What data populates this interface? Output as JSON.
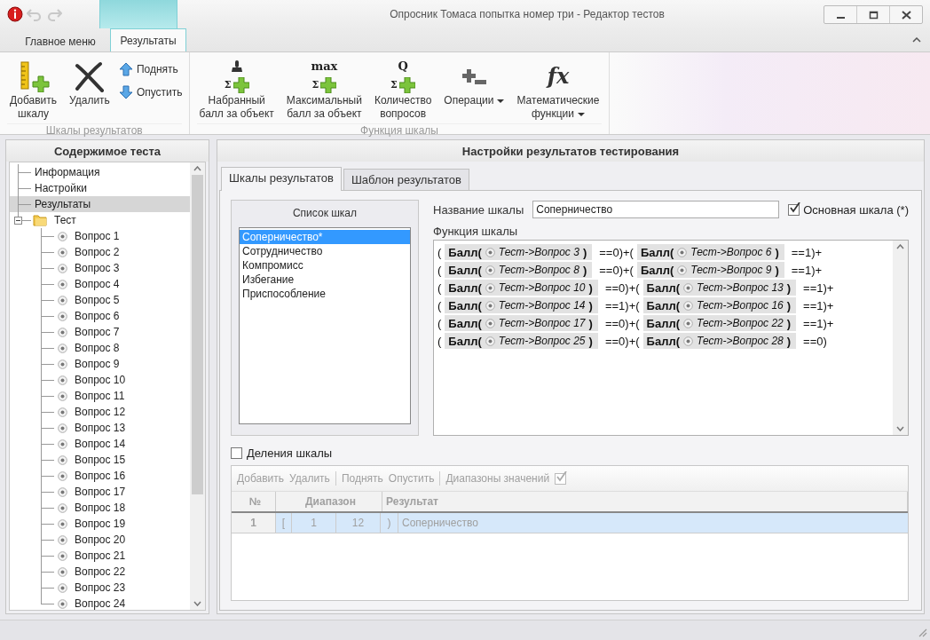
{
  "window": {
    "title": "Опросник Томаса попытка номер три - Редактор тестов"
  },
  "ribbon": {
    "tabs": [
      {
        "label": "Главное меню",
        "selected": false
      },
      {
        "label": "Результаты",
        "selected": true
      }
    ],
    "groups": [
      {
        "label": "Шкалы результатов",
        "buttons": [
          {
            "kind": "large",
            "label": "Добавить\nшкалу"
          },
          {
            "kind": "large",
            "label": "Удалить"
          },
          {
            "kind": "small",
            "label": "Поднять"
          },
          {
            "kind": "small",
            "label": "Опустить"
          }
        ]
      },
      {
        "label": "Функция шкалы",
        "buttons": [
          {
            "kind": "large",
            "label": "Набранный\nбалл за объект",
            "icon_sigma": "Σ"
          },
          {
            "kind": "large",
            "label": "Максимальный\nбалл за объект",
            "icon_text": "max",
            "icon_sigma": "Σ"
          },
          {
            "kind": "large",
            "label": "Количество\nвопросов",
            "icon_text": "Q",
            "icon_sigma": "Σ"
          },
          {
            "kind": "dropdown",
            "label": "Операции"
          },
          {
            "kind": "dropdown",
            "label": "Математические\nфункции",
            "icon_text": "fx"
          }
        ]
      }
    ]
  },
  "left_panel": {
    "title": "Содержимое теста",
    "tree": [
      {
        "label": "Информация",
        "kind": "leaf",
        "selected": false
      },
      {
        "label": "Настройки",
        "kind": "leaf",
        "selected": false
      },
      {
        "label": "Результаты",
        "kind": "leaf",
        "selected": true
      },
      {
        "label": "Тест",
        "kind": "folder",
        "selected": false,
        "expanded": true,
        "children": [
          {
            "label": "Вопрос 1",
            "kind": "question",
            "selected": false
          },
          {
            "label": "Вопрос 2",
            "kind": "question",
            "selected": false
          },
          {
            "label": "Вопрос 3",
            "kind": "question",
            "selected": false
          },
          {
            "label": "Вопрос 4",
            "kind": "question",
            "selected": false
          },
          {
            "label": "Вопрос 5",
            "kind": "question",
            "selected": false
          },
          {
            "label": "Вопрос 6",
            "kind": "question",
            "selected": false
          },
          {
            "label": "Вопрос 7",
            "kind": "question",
            "selected": false
          },
          {
            "label": "Вопрос 8",
            "kind": "question",
            "selected": false
          },
          {
            "label": "Вопрос 9",
            "kind": "question",
            "selected": false
          },
          {
            "label": "Вопрос 10",
            "kind": "question",
            "selected": false
          },
          {
            "label": "Вопрос 11",
            "kind": "question",
            "selected": false
          },
          {
            "label": "Вопрос 12",
            "kind": "question",
            "selected": false
          },
          {
            "label": "Вопрос 13",
            "kind": "question",
            "selected": false
          },
          {
            "label": "Вопрос 14",
            "kind": "question",
            "selected": false
          },
          {
            "label": "Вопрос 15",
            "kind": "question",
            "selected": false
          },
          {
            "label": "Вопрос 16",
            "kind": "question",
            "selected": false
          },
          {
            "label": "Вопрос 17",
            "kind": "question",
            "selected": false
          },
          {
            "label": "Вопрос 18",
            "kind": "question",
            "selected": false
          },
          {
            "label": "Вопрос 19",
            "kind": "question",
            "selected": false
          },
          {
            "label": "Вопрос 20",
            "kind": "question",
            "selected": false
          },
          {
            "label": "Вопрос 21",
            "kind": "question",
            "selected": false
          },
          {
            "label": "Вопрос 22",
            "kind": "question",
            "selected": false
          },
          {
            "label": "Вопрос 23",
            "kind": "question",
            "selected": false
          },
          {
            "label": "Вопрос 24",
            "kind": "question",
            "selected": false
          }
        ]
      }
    ]
  },
  "right_panel": {
    "title": "Настройки результатов тестирования",
    "tabs": [
      {
        "label": "Шкалы результатов",
        "selected": true
      },
      {
        "label": "Шаблон результатов",
        "selected": false
      }
    ],
    "scale_list": {
      "title": "Список шкал",
      "items": [
        {
          "label": "Соперничество*",
          "selected": true
        },
        {
          "label": "Сотрудничество",
          "selected": false
        },
        {
          "label": "Компромисс",
          "selected": false
        },
        {
          "label": "Избегание",
          "selected": false
        },
        {
          "label": "Приспособление",
          "selected": false
        }
      ]
    },
    "name_label": "Название шкалы",
    "name_value": "Соперничество",
    "main_scale": {
      "label": "Основная шкала (*)",
      "checked": true
    },
    "function_label": "Функция шкалы",
    "function_lines": [
      [
        {
          "kind": "text",
          "text": "("
        },
        {
          "kind": "chip",
          "func": "Балл(",
          "ref": "Тест->Вопрос 3",
          "close": ")"
        },
        {
          "kind": "text",
          "text": "==0)+("
        },
        {
          "kind": "chip",
          "func": "Балл(",
          "ref": "Тест->Вопрос 6",
          "close": ")"
        },
        {
          "kind": "text",
          "text": "==1)+"
        }
      ],
      [
        {
          "kind": "text",
          "text": "("
        },
        {
          "kind": "chip",
          "func": "Балл(",
          "ref": "Тест->Вопрос 8",
          "close": ")"
        },
        {
          "kind": "text",
          "text": "==0)+("
        },
        {
          "kind": "chip",
          "func": "Балл(",
          "ref": "Тест->Вопрос 9",
          "close": ")"
        },
        {
          "kind": "text",
          "text": "==1)+"
        }
      ],
      [
        {
          "kind": "text",
          "text": "("
        },
        {
          "kind": "chip",
          "func": "Балл(",
          "ref": "Тест->Вопрос 10",
          "close": ")"
        },
        {
          "kind": "text",
          "text": "==0)+("
        },
        {
          "kind": "chip",
          "func": "Балл(",
          "ref": "Тест->Вопрос 13",
          "close": ")"
        },
        {
          "kind": "text",
          "text": "==1)+"
        }
      ],
      [
        {
          "kind": "text",
          "text": "("
        },
        {
          "kind": "chip",
          "func": "Балл(",
          "ref": "Тест->Вопрос 14",
          "close": ")"
        },
        {
          "kind": "text",
          "text": "==1)+("
        },
        {
          "kind": "chip",
          "func": "Балл(",
          "ref": "Тест->Вопрос 16",
          "close": ")"
        },
        {
          "kind": "text",
          "text": "==1)+"
        }
      ],
      [
        {
          "kind": "text",
          "text": "("
        },
        {
          "kind": "chip",
          "func": "Балл(",
          "ref": "Тест->Вопрос 17",
          "close": ")"
        },
        {
          "kind": "text",
          "text": "==0)+("
        },
        {
          "kind": "chip",
          "func": "Балл(",
          "ref": "Тест->Вопрос 22",
          "close": ")"
        },
        {
          "kind": "text",
          "text": "==1)+"
        }
      ],
      [
        {
          "kind": "text",
          "text": "("
        },
        {
          "kind": "chip",
          "func": "Балл(",
          "ref": "Тест->Вопрос 25",
          "close": ")"
        },
        {
          "kind": "text",
          "text": "==0)+("
        },
        {
          "kind": "chip",
          "func": "Балл(",
          "ref": "Тест->Вопрос 28",
          "close": ")"
        },
        {
          "kind": "text",
          "text": "==0)"
        }
      ]
    ],
    "divisions": {
      "label": "Деления шкалы",
      "checked": false
    },
    "grid_toolbar": [
      {
        "kind": "button",
        "label": "Добавить"
      },
      {
        "kind": "button",
        "label": "Удалить"
      },
      {
        "kind": "separator"
      },
      {
        "kind": "button",
        "label": "Поднять"
      },
      {
        "kind": "button",
        "label": "Опустить"
      },
      {
        "kind": "separator"
      },
      {
        "kind": "check",
        "label": "Диапазоны значений",
        "checked": true
      }
    ],
    "grid": {
      "columns": [
        "№",
        "Диапазон",
        "Результат"
      ],
      "rows": [
        {
          "num": "1",
          "open": "[",
          "from": "1",
          "to": "12",
          "close": ")",
          "result": "Соперничество",
          "selected": true
        }
      ]
    }
  }
}
